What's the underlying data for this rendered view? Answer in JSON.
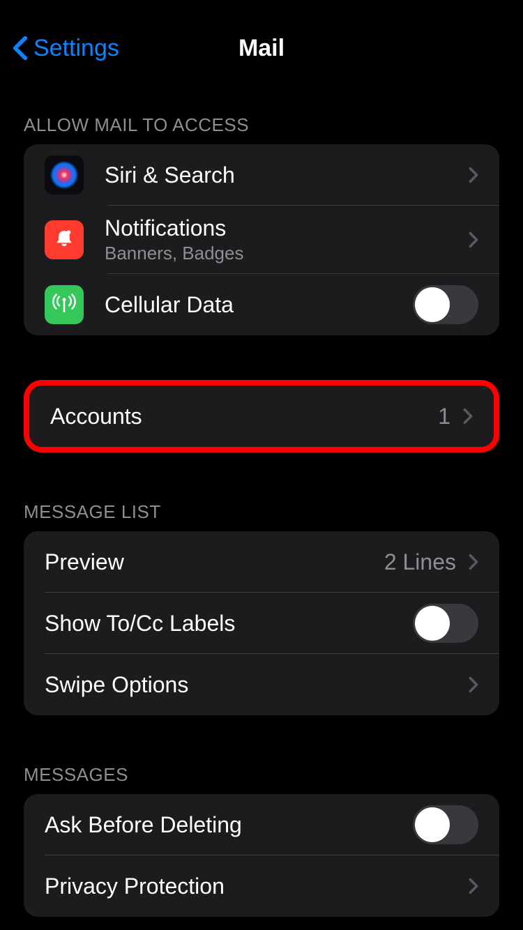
{
  "nav": {
    "back_label": "Settings",
    "title": "Mail"
  },
  "section_access": {
    "header": "ALLOW MAIL TO ACCESS",
    "siri_label": "Siri & Search",
    "notifications_label": "Notifications",
    "notifications_sub": "Banners, Badges",
    "cellular_label": "Cellular Data",
    "cellular_on": false
  },
  "section_accounts": {
    "accounts_label": "Accounts",
    "accounts_value": "1"
  },
  "section_message_list": {
    "header": "MESSAGE LIST",
    "preview_label": "Preview",
    "preview_value": "2 Lines",
    "show_tocc_label": "Show To/Cc Labels",
    "show_tocc_on": false,
    "swipe_label": "Swipe Options"
  },
  "section_messages": {
    "header": "MESSAGES",
    "ask_delete_label": "Ask Before Deleting",
    "ask_delete_on": false,
    "privacy_label": "Privacy Protection"
  }
}
